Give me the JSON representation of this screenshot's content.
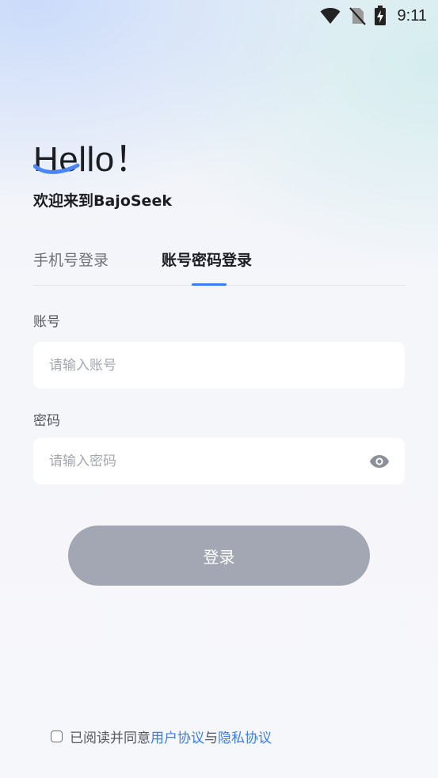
{
  "status_bar": {
    "time": "9:11",
    "icons": [
      "wifi-icon",
      "no-sim-icon",
      "battery-charging-icon"
    ]
  },
  "header": {
    "hello": "Hello！",
    "welcome": "欢迎来到BajoSeek"
  },
  "tabs": {
    "phone_login": "手机号登录",
    "account_login": "账号密码登录",
    "active": "account_login"
  },
  "form": {
    "account_label": "账号",
    "account_placeholder": "请输入账号",
    "account_value": "",
    "password_label": "密码",
    "password_placeholder": "请输入密码",
    "password_value": "",
    "eye_icon": "eye-icon"
  },
  "login_button": "登录",
  "agreement": {
    "prefix": "已阅读并同意",
    "user_agreement": "用户协议",
    "joiner": "与",
    "privacy_agreement": "隐私协议",
    "checked": false
  },
  "colors": {
    "accent": "#3b7cf0",
    "button_disabled": "#a3a7b3",
    "swoosh": "#4a86f5"
  }
}
